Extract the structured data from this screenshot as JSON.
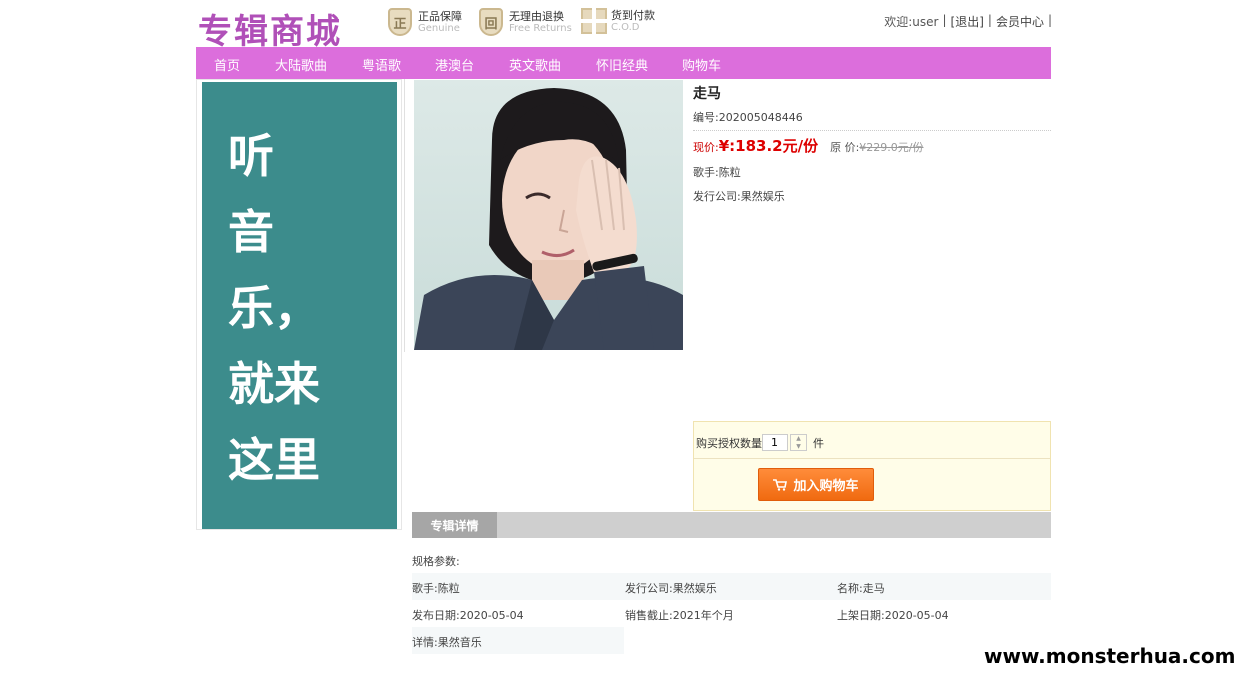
{
  "header": {
    "logo": "专辑商城",
    "badges": [
      {
        "icon": "shield-genuine-icon",
        "glyph": "正",
        "title": "正品保障",
        "subtitle": "Genuine"
      },
      {
        "icon": "shield-return-icon",
        "glyph": "回",
        "title": "无理由退换",
        "subtitle": "Free Returns"
      },
      {
        "icon": "gift-box-icon",
        "title": "货到付款",
        "subtitle": "C.O.D"
      }
    ],
    "topbar": {
      "welcome": "欢迎:user",
      "sep": "|",
      "logout": "[退出]",
      "member": "会员中心"
    }
  },
  "nav": [
    "首页",
    "大陆歌曲",
    "粤语歌",
    "港澳台",
    "英文歌曲",
    "怀旧经典",
    "购物车"
  ],
  "banner": {
    "lines": [
      "听",
      "音",
      "乐，",
      "就来",
      "这里"
    ]
  },
  "product": {
    "title": "走马",
    "code": "编号:202005048446",
    "price_label": "现价:",
    "price": "¥:183.2元/份",
    "orig_label": "原 价:",
    "orig_price": "¥229.0元/份",
    "singer": "歌手:陈粒",
    "publisher": "发行公司:果然娱乐"
  },
  "buy": {
    "qty_label": "购买授权数量",
    "qty_value": "1",
    "unit": "件",
    "add_cart": "加入购物车"
  },
  "details": {
    "tab": "专辑详情",
    "spec_title": "规格参数:",
    "rows": [
      [
        "歌手:陈粒",
        "发行公司:果然娱乐",
        "名称:走马"
      ],
      [
        "发布日期:2020-05-04",
        "销售截止:2021年个月",
        "上架日期:2020-05-04"
      ]
    ],
    "desc": "详情:果然音乐"
  },
  "watermark": "www.monsterhua.com"
}
